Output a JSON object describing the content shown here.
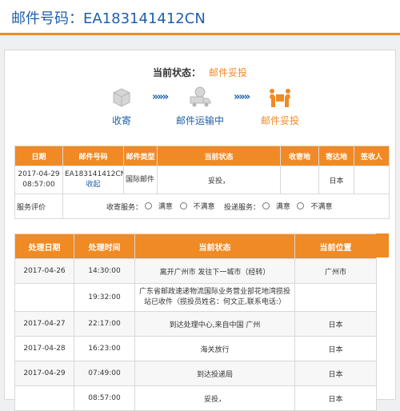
{
  "header": {
    "label": "邮件号码：",
    "number": "EA183141412CN"
  },
  "status": {
    "label": "当前状态：",
    "value": "邮件妥投"
  },
  "steps": [
    {
      "label": "收寄",
      "icon": "box-icon"
    },
    {
      "label": "邮件运输中",
      "icon": "truck-icon"
    },
    {
      "label": "邮件妥投",
      "icon": "delivered-icon"
    }
  ],
  "arrow": "»»»",
  "summary": {
    "headers": [
      "日期",
      "邮件号码",
      "邮件类型",
      "当前状态",
      "收寄地",
      "寄达地",
      "签收人"
    ],
    "row": {
      "date": "2017-04-29 08:57:00",
      "number": "EA183141412CN",
      "action": "收起",
      "type": "国际邮件",
      "status": "妥投，",
      "origin": "",
      "destination": "日本",
      "signer": ""
    },
    "rating": {
      "label": "服务评价",
      "receive_label": "收寄服务：",
      "deliver_label": "投递服务：",
      "satisfied": "满意",
      "unsatisfied": "不满意"
    }
  },
  "tracking": {
    "headers": [
      "处理日期",
      "处理时间",
      "当前状态",
      "当前位置"
    ],
    "rows": [
      {
        "date": "2017-04-26",
        "time": "14:30:00",
        "status": "离开广州市 发往下一城市（经转）",
        "location": "广州市"
      },
      {
        "date": "",
        "time": "19:32:00",
        "status": "广东省邮政速递物流国际业务营业部花地湾揽投站已收件（揽投员姓名：何文正,联系电话:）",
        "location": ""
      },
      {
        "date": "2017-04-27",
        "time": "22:17:00",
        "status": "到达处理中心,来自中国 广州",
        "location": "日本"
      },
      {
        "date": "2017-04-28",
        "time": "16:23:00",
        "status": "海关放行",
        "location": "日本"
      },
      {
        "date": "2017-04-29",
        "time": "07:49:00",
        "status": "到达投递局",
        "location": "日本"
      },
      {
        "date": "",
        "time": "08:57:00",
        "status": "妥投，",
        "location": "日本"
      }
    ]
  },
  "colors": {
    "accent": "#f08a24",
    "link": "#1f5fa8"
  }
}
